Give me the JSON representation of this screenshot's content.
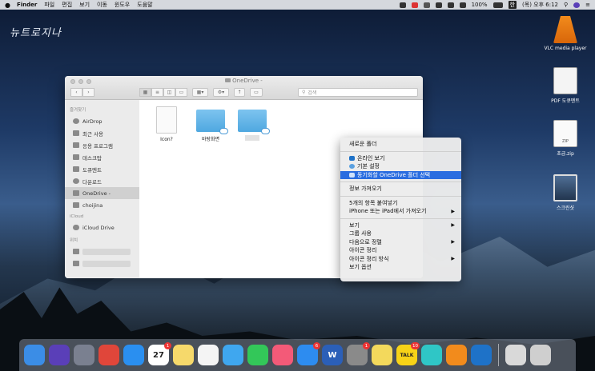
{
  "menubar": {
    "apple": "",
    "app": "Finder",
    "items": [
      "파일",
      "편집",
      "보기",
      "이동",
      "윈도우",
      "도움말"
    ],
    "battery": "100%",
    "input_badge": "한",
    "clock": "(목) 오후 6:12"
  },
  "desktop": {
    "signature": "뉴트로지나",
    "icons": [
      {
        "label": "VLC media player",
        "icon": "vlc-cone-icon"
      },
      {
        "label": "PDF 도큐멘트",
        "icon": "pdf-document-icon"
      },
      {
        "label": "초급.zip",
        "icon": "zip-file-icon",
        "ext": "ZIP"
      },
      {
        "label": "스크린샷",
        "icon": "screenshot-icon"
      }
    ]
  },
  "finder": {
    "title": "OneDrive -",
    "search_placeholder": "검색",
    "sidebar": {
      "favorites_head": "즐겨찾기",
      "favorites": [
        {
          "label": "AirDrop",
          "icon": "airdrop-icon"
        },
        {
          "label": "최근 사용",
          "icon": "recents-icon"
        },
        {
          "label": "응용 프로그램",
          "icon": "applications-icon"
        },
        {
          "label": "데스크탑",
          "icon": "desktop-icon"
        },
        {
          "label": "도큐멘트",
          "icon": "documents-icon"
        },
        {
          "label": "다운로드",
          "icon": "downloads-icon"
        },
        {
          "label": "OneDrive -",
          "icon": "folder-icon",
          "selected": true
        },
        {
          "label": "choijina",
          "icon": "home-icon"
        }
      ],
      "icloud_head": "iCloud",
      "icloud": [
        {
          "label": "iCloud Drive",
          "icon": "icloud-icon"
        }
      ],
      "locations_head": "위치"
    },
    "files": [
      {
        "label": "Icon?",
        "type": "document"
      },
      {
        "label": "바탕화면",
        "type": "folder"
      },
      {
        "label": "",
        "type": "folder"
      }
    ]
  },
  "context_menu": {
    "groups": [
      [
        {
          "label": "새로운 폴더"
        }
      ],
      [
        {
          "label": "온라인 보기",
          "icon": "onedrive-cloud-icon"
        },
        {
          "label": "기본 설정",
          "icon": "settings-icon"
        },
        {
          "label": "동기화할 OneDrive 폴더 선택",
          "icon": "sync-folder-icon",
          "highlighted": true
        }
      ],
      [
        {
          "label": "정보 가져오기"
        }
      ],
      [
        {
          "label": "5개의 항목 붙여넣기"
        },
        {
          "label": "iPhone 또는 iPad에서 가져오기",
          "submenu": true
        }
      ],
      [
        {
          "label": "보기",
          "submenu": true
        },
        {
          "label": "그룹 사용"
        },
        {
          "label": "다음으로 정렬",
          "submenu": true
        },
        {
          "label": "아이콘 정리"
        },
        {
          "label": "아이콘 정리 방식",
          "submenu": true
        },
        {
          "label": "보기 옵션"
        }
      ]
    ]
  },
  "dock": {
    "apps": [
      {
        "name": "finder-icon",
        "color": "#3b8de6"
      },
      {
        "name": "siri-icon",
        "color": "#5a3fb8"
      },
      {
        "name": "launchpad-icon",
        "color": "#7a8090"
      },
      {
        "name": "chrome-icon",
        "color": "#e0463a"
      },
      {
        "name": "safari-icon",
        "color": "#2a8ff0"
      },
      {
        "name": "calendar-icon",
        "color": "#ffffff",
        "text": "27",
        "badge": "1"
      },
      {
        "name": "notes-icon",
        "color": "#f6d96b"
      },
      {
        "name": "photos-icon",
        "color": "#f4f4f4"
      },
      {
        "name": "messages-bubble-icon",
        "color": "#3fa7ef"
      },
      {
        "name": "facetime-icon",
        "color": "#33c759"
      },
      {
        "name": "music-icon",
        "color": "#f35a78"
      },
      {
        "name": "app-store-icon",
        "color": "#2d8cf0",
        "badge": "6"
      },
      {
        "name": "word-icon",
        "color": "#2b5fb8",
        "text": "W"
      },
      {
        "name": "system-preferences-icon",
        "color": "#8a8a8a",
        "badge": "1"
      },
      {
        "name": "stickies-icon",
        "color": "#f3d95c"
      },
      {
        "name": "kakaotalk-icon",
        "color": "#f7d317",
        "text": "TALK",
        "badge": "10"
      },
      {
        "name": "clips-star-icon",
        "color": "#2fc6c6"
      },
      {
        "name": "vlc-icon",
        "color": "#f28b1c"
      },
      {
        "name": "onedrive-icon",
        "color": "#1e72c8"
      }
    ],
    "others": [
      {
        "name": "downloads-stack-icon",
        "color": "#d9d9d9"
      },
      {
        "name": "trash-icon",
        "color": "#cfcfcf"
      }
    ]
  }
}
